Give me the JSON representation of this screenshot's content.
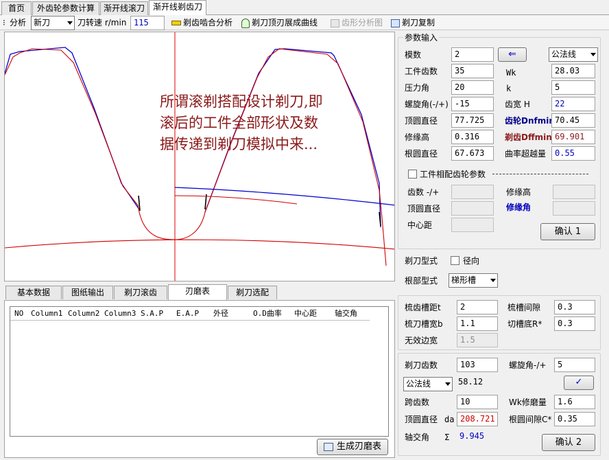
{
  "top_tabs": [
    "首页",
    "外齿轮参数计算",
    "渐开线滚刀",
    "渐开线剃齿刀"
  ],
  "toolbar": {
    "analysis_label": "分析",
    "mode_value": "新刀",
    "speed_label": "刀转速 r/min",
    "speed_value": "115",
    "mesh_analysis": "剃齿啮合分析",
    "tip_curve": "剃刀顶刃展成曲线",
    "profile_chart": "齿形分析图",
    "copy": "剃刀复制"
  },
  "canvas_text": "所谓滚剃搭配设计剃刀,即滚后的工件全部形状及数据传递到剃刀模拟中来...",
  "bottom_tabs": [
    "基本数据",
    "图纸输出",
    "剃刀滚齿",
    "刃磨表",
    "剃刀选配"
  ],
  "table_columns": [
    "NO",
    "Column1",
    "Column2",
    "Column3",
    "S.A.P",
    "E.A.P",
    "外径",
    "O.D曲率",
    "中心距",
    "轴交角"
  ],
  "generate_button": "生成刃磨表",
  "params": {
    "group_title": "参数输入",
    "module_label": "模数",
    "module_value": "2",
    "normal_select": "公法线",
    "teeth_label": "工件齿数",
    "teeth_value": "35",
    "wk_label": "Wk",
    "wk_value": "28.03",
    "pressure_label": "压力角",
    "pressure_value": "20",
    "k_label": "k",
    "k_value": "5",
    "helix_label": "螺旋角(-/+)",
    "helix_value": "-15",
    "width_label": "齿宽 H",
    "width_value": "22",
    "tip_label": "顶圆直径",
    "tip_value": "77.725",
    "gear_dnf_label": "齿轮Dnfmin",
    "gear_dnf_value": "70.45",
    "mod_label": "修缘高",
    "mod_value": "0.316",
    "shave_dff_label": "剃齿Dffmin",
    "shave_dff_value": "69.901",
    "root_label": "根圆直径",
    "root_value": "67.673",
    "curv_label": "曲率超越量",
    "curv_value": "0.55",
    "mating_label": "工件相配齿轮参数",
    "m_teeth_label": "齿数 -/+",
    "m_mod_label": "修缘高",
    "m_tip_label": "顶圆直径",
    "m_angle_label": "修缘角",
    "m_center_label": "中心距",
    "confirm1": "确认 1"
  },
  "cutter": {
    "type_label": "剃刀型式",
    "radial_label": "径向",
    "root_type_label": "根部型式",
    "root_type_value": "梯形槽",
    "pitch_label": "梳齿槽距t",
    "pitch_value": "2",
    "gap_label": "梳槽间隙",
    "gap_value": "0.3",
    "slot_width_label": "梳刀槽宽b",
    "slot_width_value": "1.1",
    "bottom_r_label": "切槽底R*",
    "bottom_r_value": "0.3",
    "invalid_label": "无效边宽",
    "invalid_value": "1.5",
    "teeth_label": "剃刀齿数",
    "teeth_value": "103",
    "helix_label": "螺旋角-/+",
    "helix_value": "5",
    "normal_select": "公法线",
    "normal_value": "58.12",
    "span_label": "跨齿数",
    "span_value": "10",
    "wk_grind_label": "Wk修磨量",
    "wk_grind_value": "1.6",
    "tip_label": "顶圆直径",
    "da_label": "da",
    "tip_value": "208.721",
    "root_gap_label": "根圆间隙C*",
    "root_gap_value": "0.35",
    "axis_label": "轴交角",
    "sigma_label": "Σ",
    "axis_value": "9.945",
    "confirm2": "确认 2"
  },
  "colors": {
    "accent_red": "#d00000",
    "accent_blue": "#0000c8",
    "dark_red": "#8b1a1a",
    "navy": "#00008b"
  }
}
